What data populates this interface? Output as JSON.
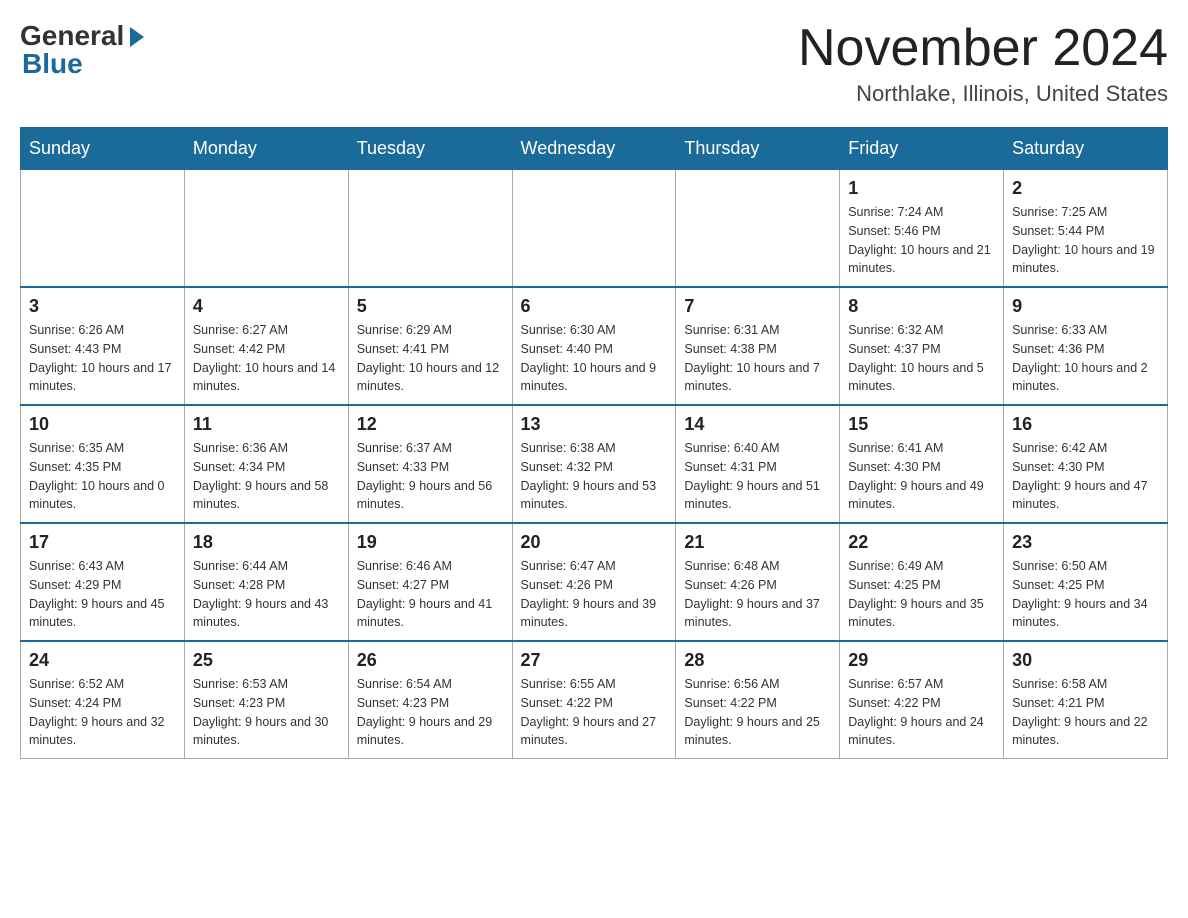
{
  "logo": {
    "general": "General",
    "blue": "Blue"
  },
  "title": "November 2024",
  "location": "Northlake, Illinois, United States",
  "days_of_week": [
    "Sunday",
    "Monday",
    "Tuesday",
    "Wednesday",
    "Thursday",
    "Friday",
    "Saturday"
  ],
  "weeks": [
    [
      {
        "day": "",
        "info": ""
      },
      {
        "day": "",
        "info": ""
      },
      {
        "day": "",
        "info": ""
      },
      {
        "day": "",
        "info": ""
      },
      {
        "day": "",
        "info": ""
      },
      {
        "day": "1",
        "info": "Sunrise: 7:24 AM\nSunset: 5:46 PM\nDaylight: 10 hours and 21 minutes."
      },
      {
        "day": "2",
        "info": "Sunrise: 7:25 AM\nSunset: 5:44 PM\nDaylight: 10 hours and 19 minutes."
      }
    ],
    [
      {
        "day": "3",
        "info": "Sunrise: 6:26 AM\nSunset: 4:43 PM\nDaylight: 10 hours and 17 minutes."
      },
      {
        "day": "4",
        "info": "Sunrise: 6:27 AM\nSunset: 4:42 PM\nDaylight: 10 hours and 14 minutes."
      },
      {
        "day": "5",
        "info": "Sunrise: 6:29 AM\nSunset: 4:41 PM\nDaylight: 10 hours and 12 minutes."
      },
      {
        "day": "6",
        "info": "Sunrise: 6:30 AM\nSunset: 4:40 PM\nDaylight: 10 hours and 9 minutes."
      },
      {
        "day": "7",
        "info": "Sunrise: 6:31 AM\nSunset: 4:38 PM\nDaylight: 10 hours and 7 minutes."
      },
      {
        "day": "8",
        "info": "Sunrise: 6:32 AM\nSunset: 4:37 PM\nDaylight: 10 hours and 5 minutes."
      },
      {
        "day": "9",
        "info": "Sunrise: 6:33 AM\nSunset: 4:36 PM\nDaylight: 10 hours and 2 minutes."
      }
    ],
    [
      {
        "day": "10",
        "info": "Sunrise: 6:35 AM\nSunset: 4:35 PM\nDaylight: 10 hours and 0 minutes."
      },
      {
        "day": "11",
        "info": "Sunrise: 6:36 AM\nSunset: 4:34 PM\nDaylight: 9 hours and 58 minutes."
      },
      {
        "day": "12",
        "info": "Sunrise: 6:37 AM\nSunset: 4:33 PM\nDaylight: 9 hours and 56 minutes."
      },
      {
        "day": "13",
        "info": "Sunrise: 6:38 AM\nSunset: 4:32 PM\nDaylight: 9 hours and 53 minutes."
      },
      {
        "day": "14",
        "info": "Sunrise: 6:40 AM\nSunset: 4:31 PM\nDaylight: 9 hours and 51 minutes."
      },
      {
        "day": "15",
        "info": "Sunrise: 6:41 AM\nSunset: 4:30 PM\nDaylight: 9 hours and 49 minutes."
      },
      {
        "day": "16",
        "info": "Sunrise: 6:42 AM\nSunset: 4:30 PM\nDaylight: 9 hours and 47 minutes."
      }
    ],
    [
      {
        "day": "17",
        "info": "Sunrise: 6:43 AM\nSunset: 4:29 PM\nDaylight: 9 hours and 45 minutes."
      },
      {
        "day": "18",
        "info": "Sunrise: 6:44 AM\nSunset: 4:28 PM\nDaylight: 9 hours and 43 minutes."
      },
      {
        "day": "19",
        "info": "Sunrise: 6:46 AM\nSunset: 4:27 PM\nDaylight: 9 hours and 41 minutes."
      },
      {
        "day": "20",
        "info": "Sunrise: 6:47 AM\nSunset: 4:26 PM\nDaylight: 9 hours and 39 minutes."
      },
      {
        "day": "21",
        "info": "Sunrise: 6:48 AM\nSunset: 4:26 PM\nDaylight: 9 hours and 37 minutes."
      },
      {
        "day": "22",
        "info": "Sunrise: 6:49 AM\nSunset: 4:25 PM\nDaylight: 9 hours and 35 minutes."
      },
      {
        "day": "23",
        "info": "Sunrise: 6:50 AM\nSunset: 4:25 PM\nDaylight: 9 hours and 34 minutes."
      }
    ],
    [
      {
        "day": "24",
        "info": "Sunrise: 6:52 AM\nSunset: 4:24 PM\nDaylight: 9 hours and 32 minutes."
      },
      {
        "day": "25",
        "info": "Sunrise: 6:53 AM\nSunset: 4:23 PM\nDaylight: 9 hours and 30 minutes."
      },
      {
        "day": "26",
        "info": "Sunrise: 6:54 AM\nSunset: 4:23 PM\nDaylight: 9 hours and 29 minutes."
      },
      {
        "day": "27",
        "info": "Sunrise: 6:55 AM\nSunset: 4:22 PM\nDaylight: 9 hours and 27 minutes."
      },
      {
        "day": "28",
        "info": "Sunrise: 6:56 AM\nSunset: 4:22 PM\nDaylight: 9 hours and 25 minutes."
      },
      {
        "day": "29",
        "info": "Sunrise: 6:57 AM\nSunset: 4:22 PM\nDaylight: 9 hours and 24 minutes."
      },
      {
        "day": "30",
        "info": "Sunrise: 6:58 AM\nSunset: 4:21 PM\nDaylight: 9 hours and 22 minutes."
      }
    ]
  ]
}
